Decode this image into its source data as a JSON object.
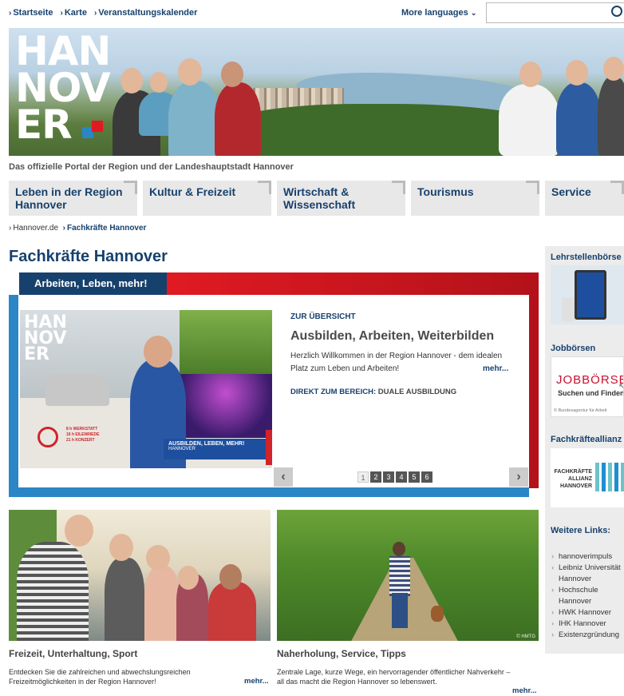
{
  "topnav": {
    "items": [
      "Startseite",
      "Karte",
      "Veranstaltungskalender"
    ],
    "more_languages": "More languages"
  },
  "hero": {
    "logo_lines": [
      "HAN",
      "NOV",
      "ER"
    ]
  },
  "tagline": "Das offizielle Portal der Region und der Landeshauptstadt Hannover",
  "mainnav": [
    "Leben in der Region Hannover",
    "Kultur & Freizeit",
    "Wirtschaft & Wissenschaft",
    "Tourismus",
    "Service"
  ],
  "breadcrumb": [
    "Hannover.de",
    "Fachkräfte Hannover"
  ],
  "page_title": "Fachkräfte Hannover",
  "slider": {
    "tab": "Arbeiten, Leben, mehr!",
    "overview": "ZUR ÜBERSICHT",
    "title": "Ausbilden, Arbeiten, Weiterbilden",
    "text": "Herzlich Willkommen in der Region Hannover - dem idealen Platz zum Leben und Arbeiten!",
    "more": "mehr...",
    "direct_label": "DIREKT ZUM BEREICH:",
    "direct_value": "DUALE AUSBILDUNG",
    "image_logo": [
      "HAN",
      "NOV",
      "ER"
    ],
    "image_caption_1": "AUSBILDEN, LEBEN, MEHR!",
    "image_caption_2": "HANNOVER",
    "image_small_text": [
      "8 h  WERKSTATT",
      "16 h  EILENRIEDE",
      "21 h  KONZERT"
    ],
    "pages": [
      "1",
      "2",
      "3",
      "4",
      "5",
      "6"
    ],
    "active_page": "1"
  },
  "teasers": [
    {
      "title": "Freizeit, Unterhaltung, Sport",
      "text": "Entdecken Sie die zahlreichen und abwechslungsreichen Freizeitmöglichkeiten in der Region Hannover!",
      "more": "mehr..."
    },
    {
      "title": "Naherholung, Service, Tipps",
      "text": "Zentrale Lage, kurze Wege, ein hervorragender öffentlicher Nahverkehr – all das macht die Region Hannover so lebenswert.",
      "more": "mehr...",
      "credit": "© HMTG"
    }
  ],
  "sidebar": {
    "lehrstellen": "Lehrstellenbörse",
    "jobboersen": "Jobbörsen",
    "jobboerse_logo": "JOBBÖRSE",
    "jobboerse_sub": "Suchen und Finden",
    "jobboerse_credit": "© Bundesagentur für Arbeit",
    "allianz": "Fachkräfteallianz",
    "allianz_logo": [
      "FACHKRÄFTE",
      "ALLIANZ",
      "HANNOVER"
    ],
    "weitere": "Weitere Links:",
    "links": [
      "hannoverimpuls",
      "Leibniz Universität Hannover",
      "Hochschule Hannover",
      "HWK Hannover",
      "IHK Hannover",
      "Existenzgründung"
    ]
  },
  "colors": {
    "brand_blue": "#17416d",
    "accent_red": "#e01a22",
    "accent_light_blue": "#2b86c6"
  }
}
